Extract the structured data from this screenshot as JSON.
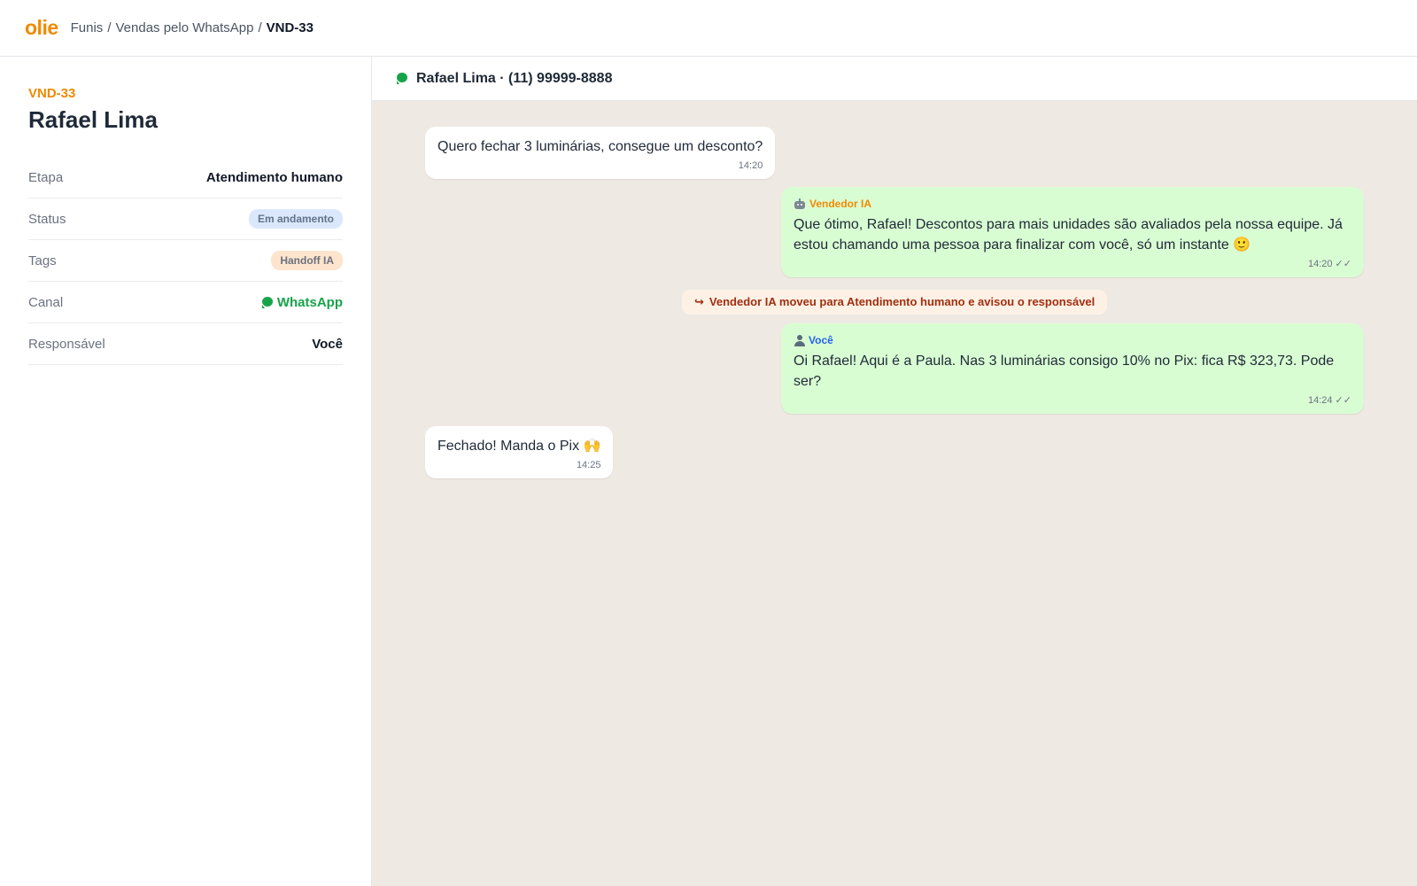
{
  "header": {
    "logo": "olie",
    "breadcrumb": [
      "Funis",
      "Vendas pelo WhatsApp",
      "VND-33"
    ],
    "separator": "/"
  },
  "deal": {
    "id": "VND-33",
    "name": "Rafael Lima",
    "fields": {
      "etapa": {
        "label": "Etapa",
        "value": "Atendimento humano"
      },
      "status": {
        "label": "Status",
        "value": "Em andamento"
      },
      "tags": {
        "label": "Tags",
        "value": "Handoff IA"
      },
      "canal": {
        "label": "Canal",
        "value": "WhatsApp",
        "icon": "whatsapp-icon"
      },
      "responsavel": {
        "label": "Responsável",
        "value": "Você"
      }
    }
  },
  "chat": {
    "title": "Rafael Lima · (11) 99999-8888",
    "messages": [
      {
        "direction": "in",
        "text": "Quero fechar 3 luminárias, consegue um desconto?",
        "time": "14:20"
      },
      {
        "direction": "out",
        "sender": "Vendedor IA",
        "sender_icon": "robot-icon",
        "text": "Que ótimo, Rafael! Descontos para mais unidades são avaliados pela nossa equipe. Já estou chamando uma pessoa para finalizar com você, só um instante 🙂",
        "time": "14:20 ✓✓"
      },
      {
        "direction": "out",
        "sender": "Você",
        "sender_icon": "person-icon",
        "text": "Oi Rafael! Aqui é a Paula. Nas 3 luminárias consigo 10% no Pix: fica R$ 323,73. Pode ser?",
        "time": "14:24 ✓✓"
      },
      {
        "direction": "in",
        "text": "Fechado! Manda o Pix 🙌",
        "time": "14:25"
      }
    ],
    "event": {
      "icon": "↪",
      "text": "Vendedor IA moveu para Atendimento humano e avisou o responsável"
    }
  },
  "colors": {
    "brand": "#f08a00",
    "whatsapp": "#17a34a",
    "outgoing_bubble": "#d9fdd3",
    "chat_background": "#eee9e2"
  }
}
